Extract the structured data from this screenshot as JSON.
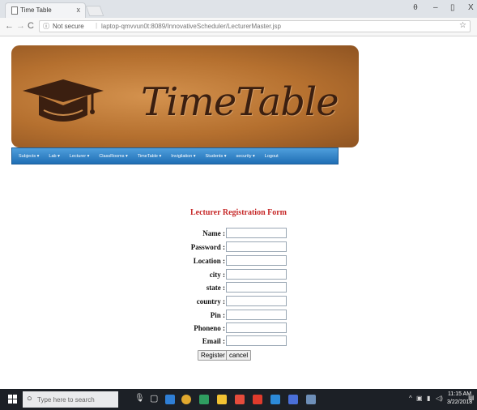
{
  "browser": {
    "tab_title": "Time Table",
    "tab_close": "x",
    "not_secure": "Not secure",
    "url": "laptop-qmvvun0t:8089/InnovativeScheduler/LecturerMaster.jsp",
    "window_minimize": "–",
    "window_restore": "▯",
    "window_close": "X",
    "account_icon": "⍬"
  },
  "banner": {
    "title": "TimeTable"
  },
  "nav": {
    "items": [
      {
        "label": "Subjects ▾"
      },
      {
        "label": "Lab ▾"
      },
      {
        "label": "Lecturer ▾"
      },
      {
        "label": "ClassRooms ▾"
      },
      {
        "label": "TimeTable ▾"
      },
      {
        "label": "Invigilation ▾"
      },
      {
        "label": "Students ▾"
      },
      {
        "label": "security ▾"
      },
      {
        "label": "Logout"
      }
    ]
  },
  "form": {
    "title": "Lecturer Registration Form",
    "fields": [
      {
        "label": "Name :",
        "value": ""
      },
      {
        "label": "Password :",
        "value": ""
      },
      {
        "label": "Location :",
        "value": ""
      },
      {
        "label": "city :",
        "value": ""
      },
      {
        "label": "state :",
        "value": ""
      },
      {
        "label": "country :",
        "value": ""
      },
      {
        "label": "Pin :",
        "value": ""
      },
      {
        "label": "Phoneno :",
        "value": ""
      },
      {
        "label": "Email :",
        "value": ""
      }
    ],
    "register_label": "Register",
    "cancel_label": "cancel"
  },
  "taskbar": {
    "search_placeholder": "Type here to search",
    "time": "11:15 AM",
    "date": "3/22/2018"
  },
  "colors": {
    "nav_bar": "#2a7fc4",
    "form_title": "#c62828",
    "banner": "#b5702f",
    "taskbar": "#1c2026"
  }
}
